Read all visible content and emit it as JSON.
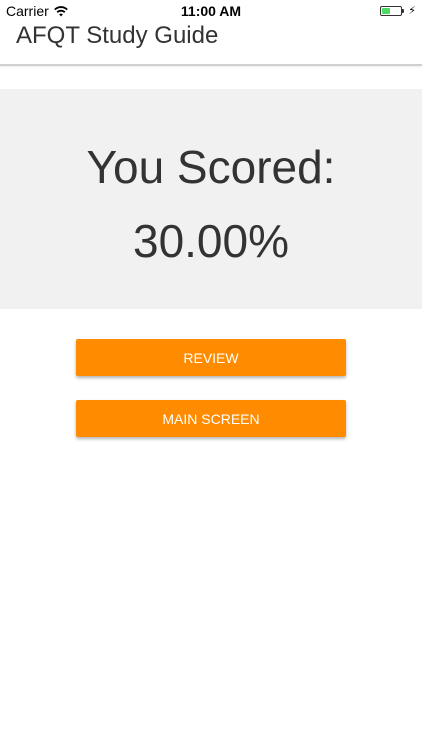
{
  "status_bar": {
    "carrier": "Carrier",
    "time": "11:00 AM",
    "battery_level": 0.45,
    "wifi_icon": "wifi-icon",
    "charging_icon": "bolt-icon"
  },
  "header": {
    "title": "AFQT Study Guide"
  },
  "score": {
    "heading": "You Scored:",
    "value": "30.00%"
  },
  "actions": {
    "review_label": "REVIEW",
    "main_screen_label": "MAIN SCREEN"
  },
  "colors": {
    "accent": "#FF8C00",
    "panel_bg": "#F1F1F1",
    "text": "#333333",
    "battery_fill": "#4CD964"
  }
}
